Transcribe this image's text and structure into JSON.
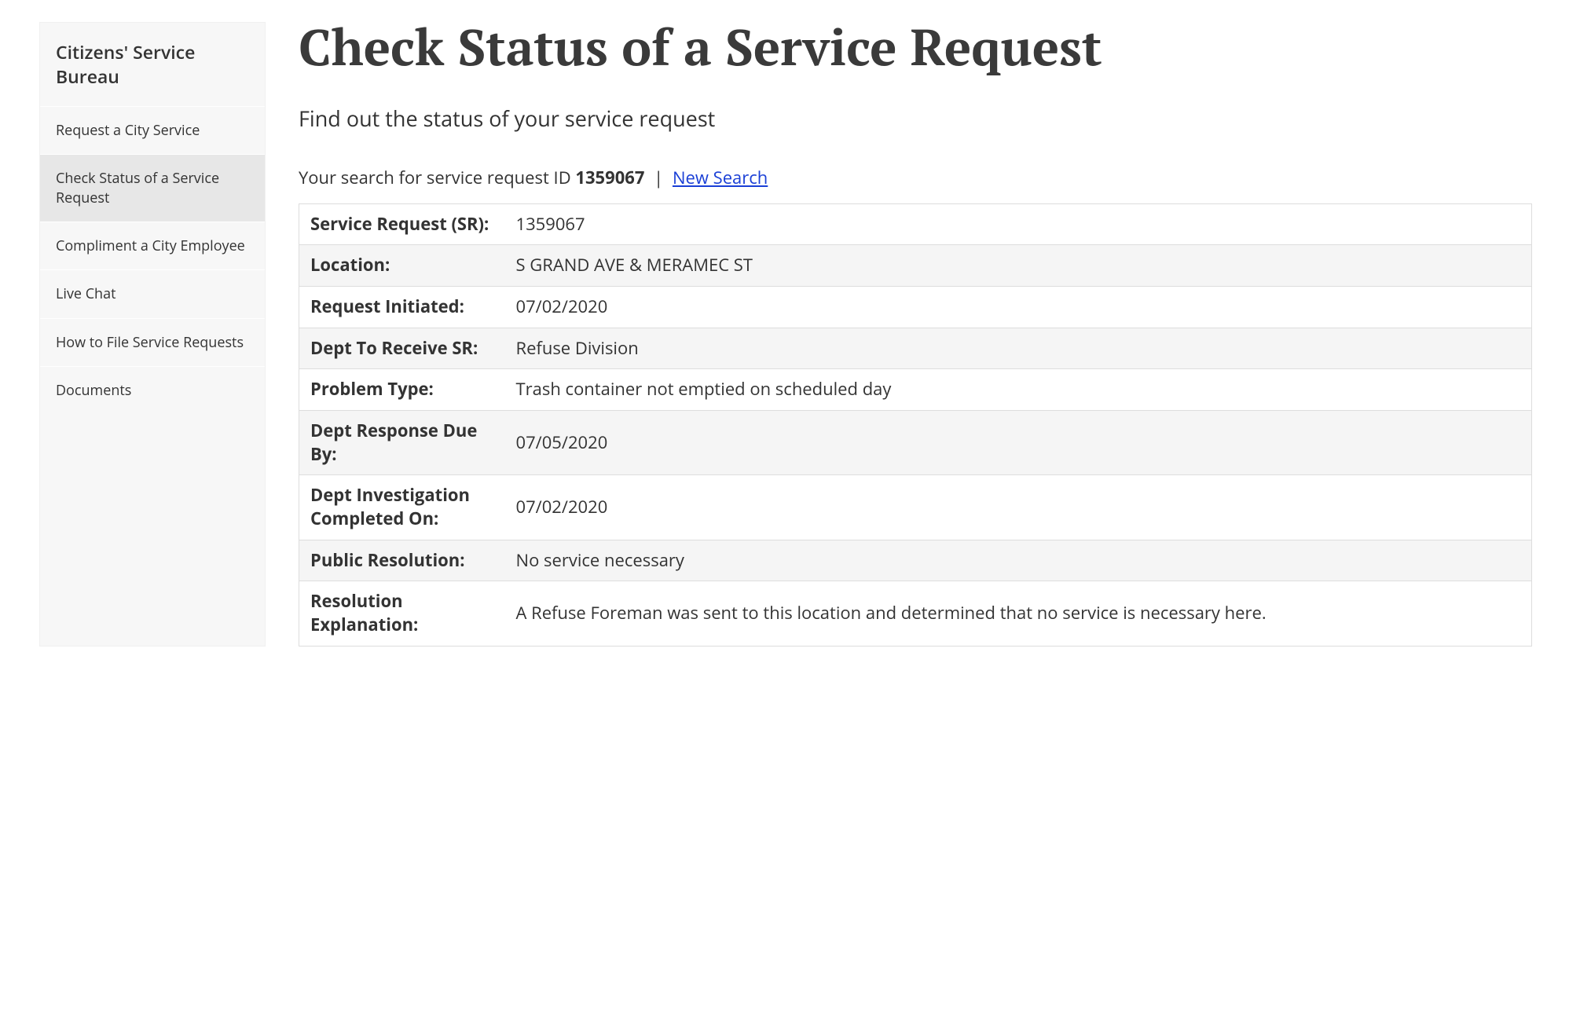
{
  "sidebar": {
    "header": "Citizens' Service Bureau",
    "items": [
      {
        "label": "Request a City Service",
        "active": false
      },
      {
        "label": "Check Status of a Service Request",
        "active": true
      },
      {
        "label": "Compliment a City Employee",
        "active": false
      },
      {
        "label": "Live Chat",
        "active": false
      },
      {
        "label": "How to File Service Requests",
        "active": false
      },
      {
        "label": "Documents",
        "active": false
      }
    ]
  },
  "main": {
    "title": "Check Status of a Service Request",
    "subtitle": "Find out the status of your service request",
    "search_prefix": "Your search for service request ID ",
    "search_id": "1359067",
    "separator": " | ",
    "new_search": "New Search",
    "rows": [
      {
        "label": "Service Request (SR):",
        "value": "1359067"
      },
      {
        "label": "Location:",
        "value": "S GRAND AVE & MERAMEC ST"
      },
      {
        "label": "Request Initiated:",
        "value": "07/02/2020"
      },
      {
        "label": "Dept To Receive SR:",
        "value": "Refuse Division"
      },
      {
        "label": "Problem Type:",
        "value": "Trash container not emptied on scheduled day"
      },
      {
        "label": "Dept Response Due By:",
        "value": "07/05/2020"
      },
      {
        "label": "Dept Investigation Completed On:",
        "value": "07/02/2020"
      },
      {
        "label": "Public Resolution:",
        "value": "No service necessary"
      },
      {
        "label": "Resolution Explanation:",
        "value": "A Refuse Foreman was sent to this location and determined that no service is necessary here."
      }
    ]
  }
}
